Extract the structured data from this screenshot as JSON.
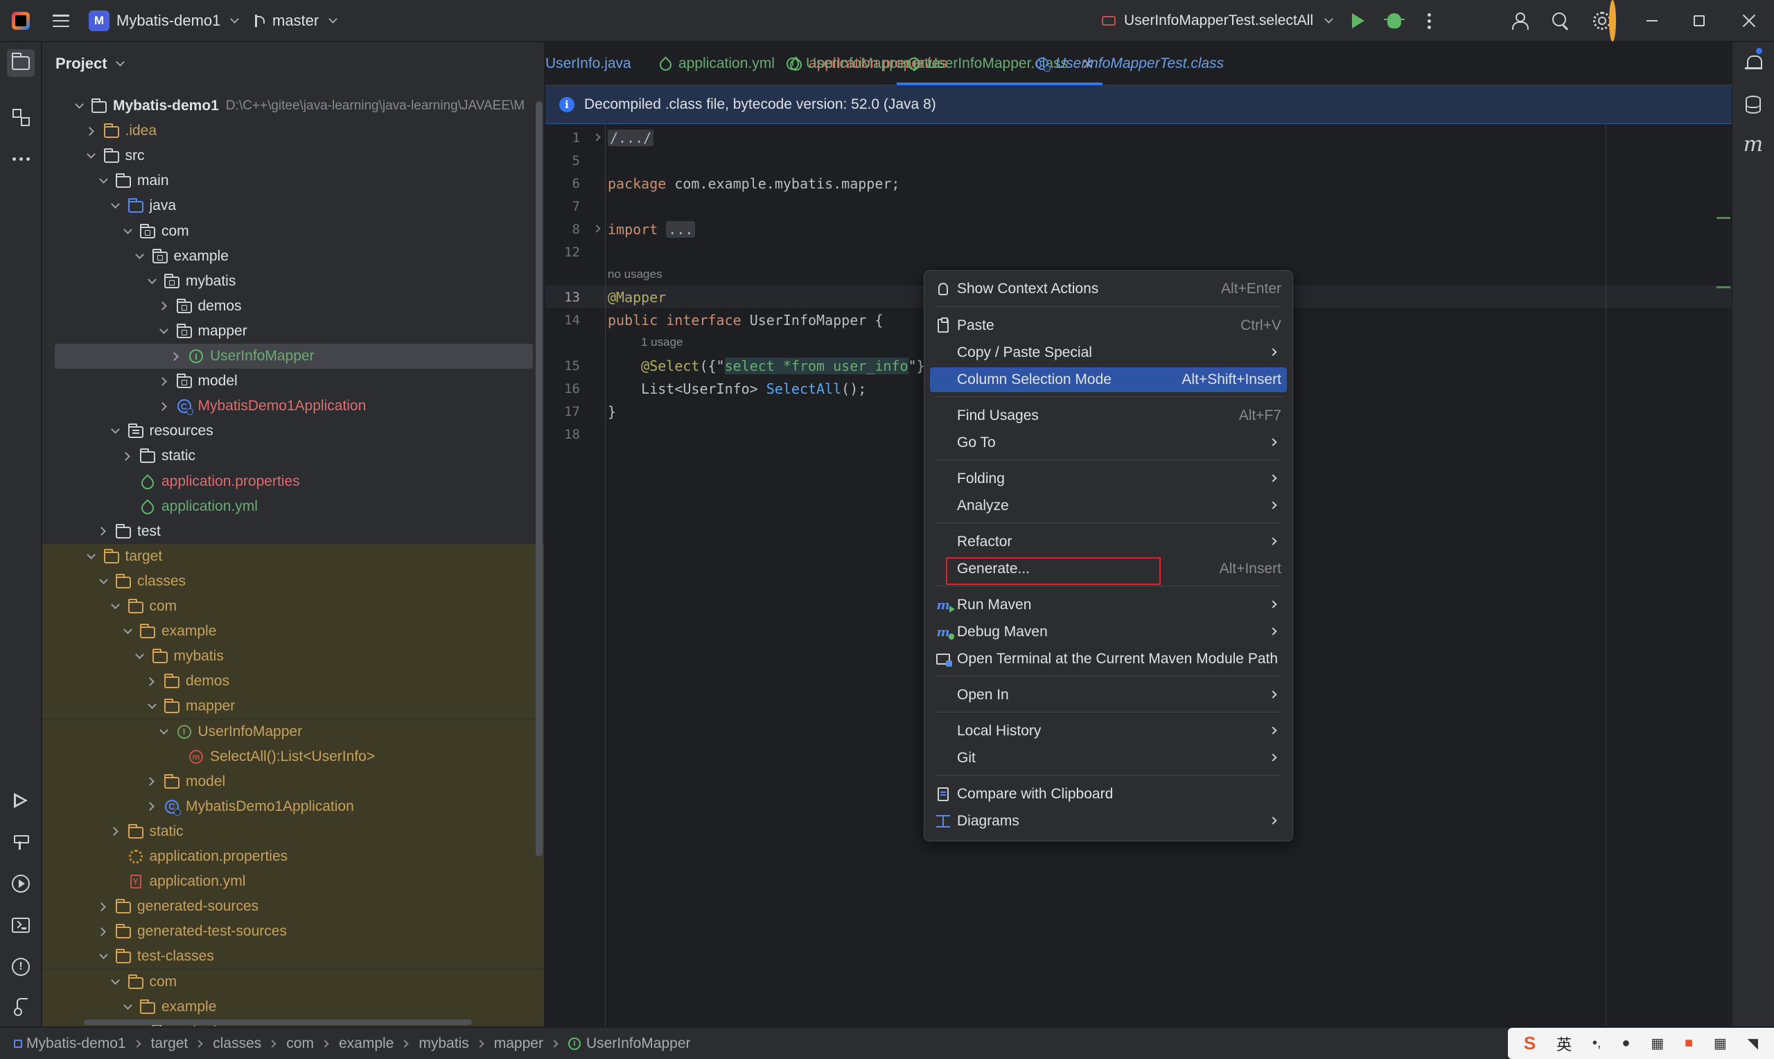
{
  "titlebar": {
    "project_badge": "M",
    "project_name": "Mybatis-demo1",
    "branch": "master",
    "run_config": "UserInfoMapperTest.selectAll"
  },
  "project_panel": {
    "title": "Project",
    "tree": [
      {
        "label": "Mybatis-demo1",
        "extra": "D:\\C++\\gitee\\java-learning\\java-learning\\JAVAEE\\M",
        "indent": 0,
        "arrow": "open",
        "icon": "module",
        "color": "white",
        "bold": true
      },
      {
        "label": ".idea",
        "indent": 1,
        "arrow": "closed",
        "icon": "folder",
        "color": "yellow"
      },
      {
        "label": "src",
        "indent": 1,
        "arrow": "open",
        "icon": "folder",
        "color": "white"
      },
      {
        "label": "main",
        "indent": 2,
        "arrow": "open",
        "icon": "folder",
        "color": "white"
      },
      {
        "label": "java",
        "indent": 3,
        "arrow": "open",
        "icon": "folder-blue",
        "color": "white"
      },
      {
        "label": "com",
        "indent": 4,
        "arrow": "open",
        "icon": "package",
        "color": "white"
      },
      {
        "label": "example",
        "indent": 5,
        "arrow": "open",
        "icon": "package",
        "color": "white"
      },
      {
        "label": "mybatis",
        "indent": 6,
        "arrow": "open",
        "icon": "package",
        "color": "white"
      },
      {
        "label": "demos",
        "indent": 7,
        "arrow": "closed",
        "icon": "package",
        "color": "white"
      },
      {
        "label": "mapper",
        "indent": 7,
        "arrow": "open",
        "icon": "package",
        "color": "white"
      },
      {
        "label": "UserInfoMapper",
        "indent": 8,
        "arrow": "closed",
        "icon": "interface",
        "color": "green",
        "selected": true
      },
      {
        "label": "model",
        "indent": 7,
        "arrow": "closed",
        "icon": "package",
        "color": "white"
      },
      {
        "label": "MybatisDemo1Application",
        "indent": 7,
        "arrow": "closed",
        "icon": "class",
        "color": "red"
      },
      {
        "label": "resources",
        "indent": 3,
        "arrow": "open",
        "icon": "folder-res",
        "color": "white"
      },
      {
        "label": "static",
        "indent": 4,
        "arrow": "closed",
        "icon": "folder",
        "color": "white"
      },
      {
        "label": "application.properties",
        "indent": 4,
        "arrow": "none",
        "icon": "spring",
        "color": "red"
      },
      {
        "label": "application.yml",
        "indent": 4,
        "arrow": "none",
        "icon": "spring",
        "color": "green"
      },
      {
        "label": "test",
        "indent": 2,
        "arrow": "closed",
        "icon": "folder",
        "color": "white"
      },
      {
        "label": "target",
        "indent": 1,
        "arrow": "open",
        "icon": "folder-yellow",
        "color": "yellow",
        "excluded": true
      },
      {
        "label": "classes",
        "indent": 2,
        "arrow": "open",
        "icon": "folder-yellow",
        "color": "yellow",
        "excluded": true
      },
      {
        "label": "com",
        "indent": 3,
        "arrow": "open",
        "icon": "folder-yellow",
        "color": "yellow",
        "excluded": true
      },
      {
        "label": "example",
        "indent": 4,
        "arrow": "open",
        "icon": "folder-yellow",
        "color": "yellow",
        "excluded": true
      },
      {
        "label": "mybatis",
        "indent": 5,
        "arrow": "open",
        "icon": "folder-yellow",
        "color": "yellow",
        "excluded": true
      },
      {
        "label": "demos",
        "indent": 6,
        "arrow": "closed",
        "icon": "folder-yellow",
        "color": "yellow",
        "excluded": true
      },
      {
        "label": "mapper",
        "indent": 6,
        "arrow": "open",
        "icon": "folder-yellow",
        "color": "yellow",
        "excluded": true
      },
      {
        "label": "UserInfoMapper",
        "indent": 7,
        "arrow": "open",
        "icon": "interface-dim",
        "color": "yellow",
        "excluded": true
      },
      {
        "label": "SelectAll():List<UserInfo>",
        "indent": 8,
        "arrow": "none",
        "icon": "method",
        "color": "yellow",
        "excluded": true
      },
      {
        "label": "model",
        "indent": 6,
        "arrow": "closed",
        "icon": "folder-yellow",
        "color": "yellow",
        "excluded": true
      },
      {
        "label": "MybatisDemo1Application",
        "indent": 6,
        "arrow": "closed",
        "icon": "class",
        "color": "yellow",
        "excluded": true
      },
      {
        "label": "static",
        "indent": 3,
        "arrow": "closed",
        "icon": "folder-yellow",
        "color": "yellow",
        "excluded": true
      },
      {
        "label": "application.properties",
        "indent": 3,
        "arrow": "none",
        "icon": "gear",
        "color": "yellow",
        "excluded": true
      },
      {
        "label": "application.yml",
        "indent": 3,
        "arrow": "none",
        "icon": "yml",
        "color": "yellow",
        "excluded": true
      },
      {
        "label": "generated-sources",
        "indent": 2,
        "arrow": "closed",
        "icon": "folder-yellow",
        "color": "yellow",
        "excluded": true
      },
      {
        "label": "generated-test-sources",
        "indent": 2,
        "arrow": "closed",
        "icon": "folder-yellow",
        "color": "yellow",
        "excluded": true
      },
      {
        "label": "test-classes",
        "indent": 2,
        "arrow": "open",
        "icon": "folder-yellow",
        "color": "yellow",
        "excluded": true
      },
      {
        "label": "com",
        "indent": 3,
        "arrow": "open",
        "icon": "folder-yellow",
        "color": "yellow",
        "excluded": true
      },
      {
        "label": "example",
        "indent": 4,
        "arrow": "open",
        "icon": "folder-yellow",
        "color": "yellow",
        "excluded": true
      },
      {
        "label": "mybatis",
        "indent": 5,
        "arrow": "open",
        "icon": "folder-yellow",
        "color": "yellow",
        "excluded": true
      }
    ]
  },
  "editor_tabs": [
    {
      "label": "UserInfo.java",
      "color": "#6c9ee8",
      "icon": "none"
    },
    {
      "label": "application.yml",
      "color": "#6aab73",
      "icon": "spring"
    },
    {
      "label": "application.properties",
      "color": "#e06c6c",
      "icon": "spring"
    },
    {
      "label": "UserInfoMapper.java",
      "color": "#6aab73",
      "icon": "interface"
    },
    {
      "label": "UserInfoMapper.class",
      "color": "#6aab73",
      "icon": "interface",
      "active": true
    },
    {
      "label": "UserInfoMapperTest.class",
      "color": "#6c9ee8",
      "icon": "class",
      "italic": true
    }
  ],
  "banner": {
    "text": "Decompiled .class file, bytecode version: 52.0 (Java 8)"
  },
  "editor": {
    "line_numbers": [
      "1",
      "5",
      "6",
      "7",
      "8",
      "12",
      "13",
      "14",
      "15",
      "16",
      "17",
      "18"
    ],
    "hint_no_usages": "no usages",
    "hint_one_usage": "1 usage",
    "code": {
      "l1": "/.../",
      "l6_kw": "package",
      "l6_rest": " com.example.mybatis.mapper;",
      "l8_kw": "import",
      "l8_folded": "...",
      "l13": "@Mapper",
      "l14_kw1": "public",
      "l14_kw2": "interface",
      "l14_rest": " UserInfoMapper {",
      "l15_ann": "@Select",
      "l15_open": "({\"",
      "l15_str": "select *from user_info",
      "l15_close": "\"}",
      "l16_type": "List<UserInfo> ",
      "l16_method": "SelectAll",
      "l16_end": "();",
      "l17": "}"
    }
  },
  "context_menu": {
    "items": [
      {
        "label": "Show Context Actions",
        "shortcut": "Alt+Enter",
        "icon": "bulb-icon"
      },
      {
        "label": "Paste",
        "shortcut": "Ctrl+V",
        "icon": "paste-icon"
      },
      {
        "label": "Copy / Paste Special",
        "submenu": true
      },
      {
        "label": "Column Selection Mode",
        "shortcut": "Alt+Shift+Insert",
        "selected": true
      },
      {
        "label": "Find Usages",
        "shortcut": "Alt+F7"
      },
      {
        "label": "Go To",
        "submenu": true
      },
      {
        "label": "Folding",
        "submenu": true
      },
      {
        "label": "Analyze",
        "submenu": true
      },
      {
        "label": "Refactor",
        "submenu": true
      },
      {
        "label": "Generate...",
        "shortcut": "Alt+Insert"
      },
      {
        "label": "Run Maven",
        "submenu": true,
        "icon": "maven-run-icon"
      },
      {
        "label": "Debug Maven",
        "submenu": true,
        "icon": "maven-debug-icon"
      },
      {
        "label": "Open Terminal at the Current Maven Module Path",
        "icon": "terminal-maven-icon"
      },
      {
        "label": "Open In",
        "submenu": true
      },
      {
        "label": "Local History",
        "submenu": true
      },
      {
        "label": "Git",
        "submenu": true
      },
      {
        "label": "Compare with Clipboard",
        "icon": "clipboard-compare-icon"
      },
      {
        "label": "Diagrams",
        "submenu": true,
        "icon": "diagram-icon"
      }
    ]
  },
  "statusbar": {
    "breadcrumbs": [
      "Mybatis-demo1",
      "target",
      "classes",
      "com",
      "example",
      "mybatis",
      "mapper",
      "UserInfoMapper"
    ]
  },
  "ime": {
    "brand": "S",
    "lang": "英"
  },
  "colors": {
    "accent": "#3574f0",
    "selected_menu": "#2e55a3",
    "highlight_box": "#e0202b",
    "excluded_bg": "#3d3a26"
  }
}
